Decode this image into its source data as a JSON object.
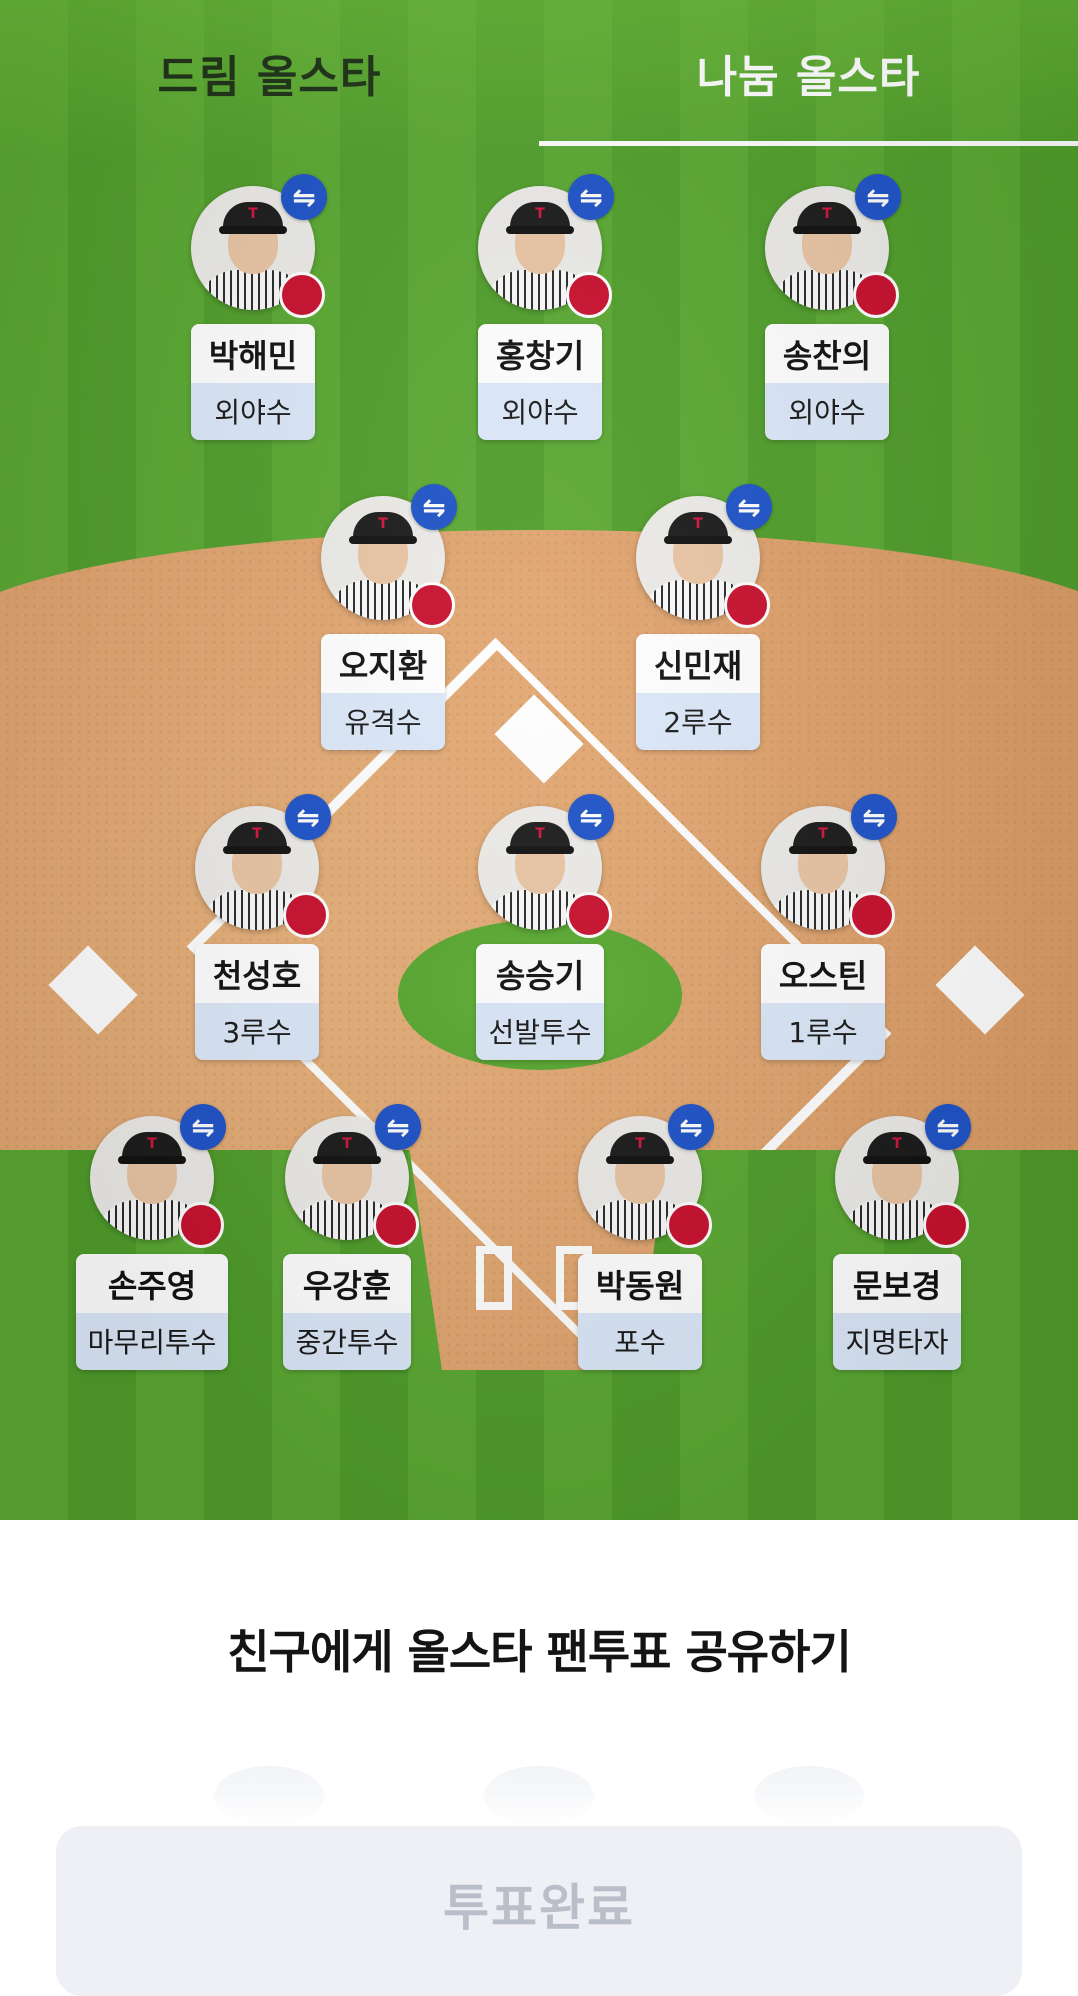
{
  "tabs": [
    {
      "label": "드림 올스타",
      "active": false
    },
    {
      "label": "나눔 올스타",
      "active": true
    }
  ],
  "players": [
    {
      "name": "박해민",
      "position": "외야수",
      "team": "TWINS"
    },
    {
      "name": "홍창기",
      "position": "외야수",
      "team": "TWINS"
    },
    {
      "name": "송찬의",
      "position": "외야수",
      "team": "TWINS"
    },
    {
      "name": "오지환",
      "position": "유격수",
      "team": "TWINS"
    },
    {
      "name": "신민재",
      "position": "2루수",
      "team": "TWINS"
    },
    {
      "name": "천성호",
      "position": "3루수",
      "team": "TWINS"
    },
    {
      "name": "송승기",
      "position": "선발투수",
      "team": "TWINS"
    },
    {
      "name": "오스틴",
      "position": "1루수",
      "team": "TWINS"
    },
    {
      "name": "손주영",
      "position": "마무리투수",
      "team": "TWINS"
    },
    {
      "name": "우강훈",
      "position": "중간투수",
      "team": "TWINS"
    },
    {
      "name": "박동원",
      "position": "포수",
      "team": "TWINS"
    },
    {
      "name": "문보경",
      "position": "지명타자",
      "team": "TWINS"
    }
  ],
  "icons": {
    "swap": "swap-icon",
    "team": "lg-twins-logo",
    "swap_glyph": "⇋"
  },
  "colors": {
    "swap": "#1e53c8",
    "team": "#c8102e",
    "position_bg": "#dce8f9"
  },
  "share": {
    "title": "친구에게 올스타 팬투표 공유하기"
  },
  "vote_button": {
    "label": "투표완료",
    "enabled": false
  }
}
